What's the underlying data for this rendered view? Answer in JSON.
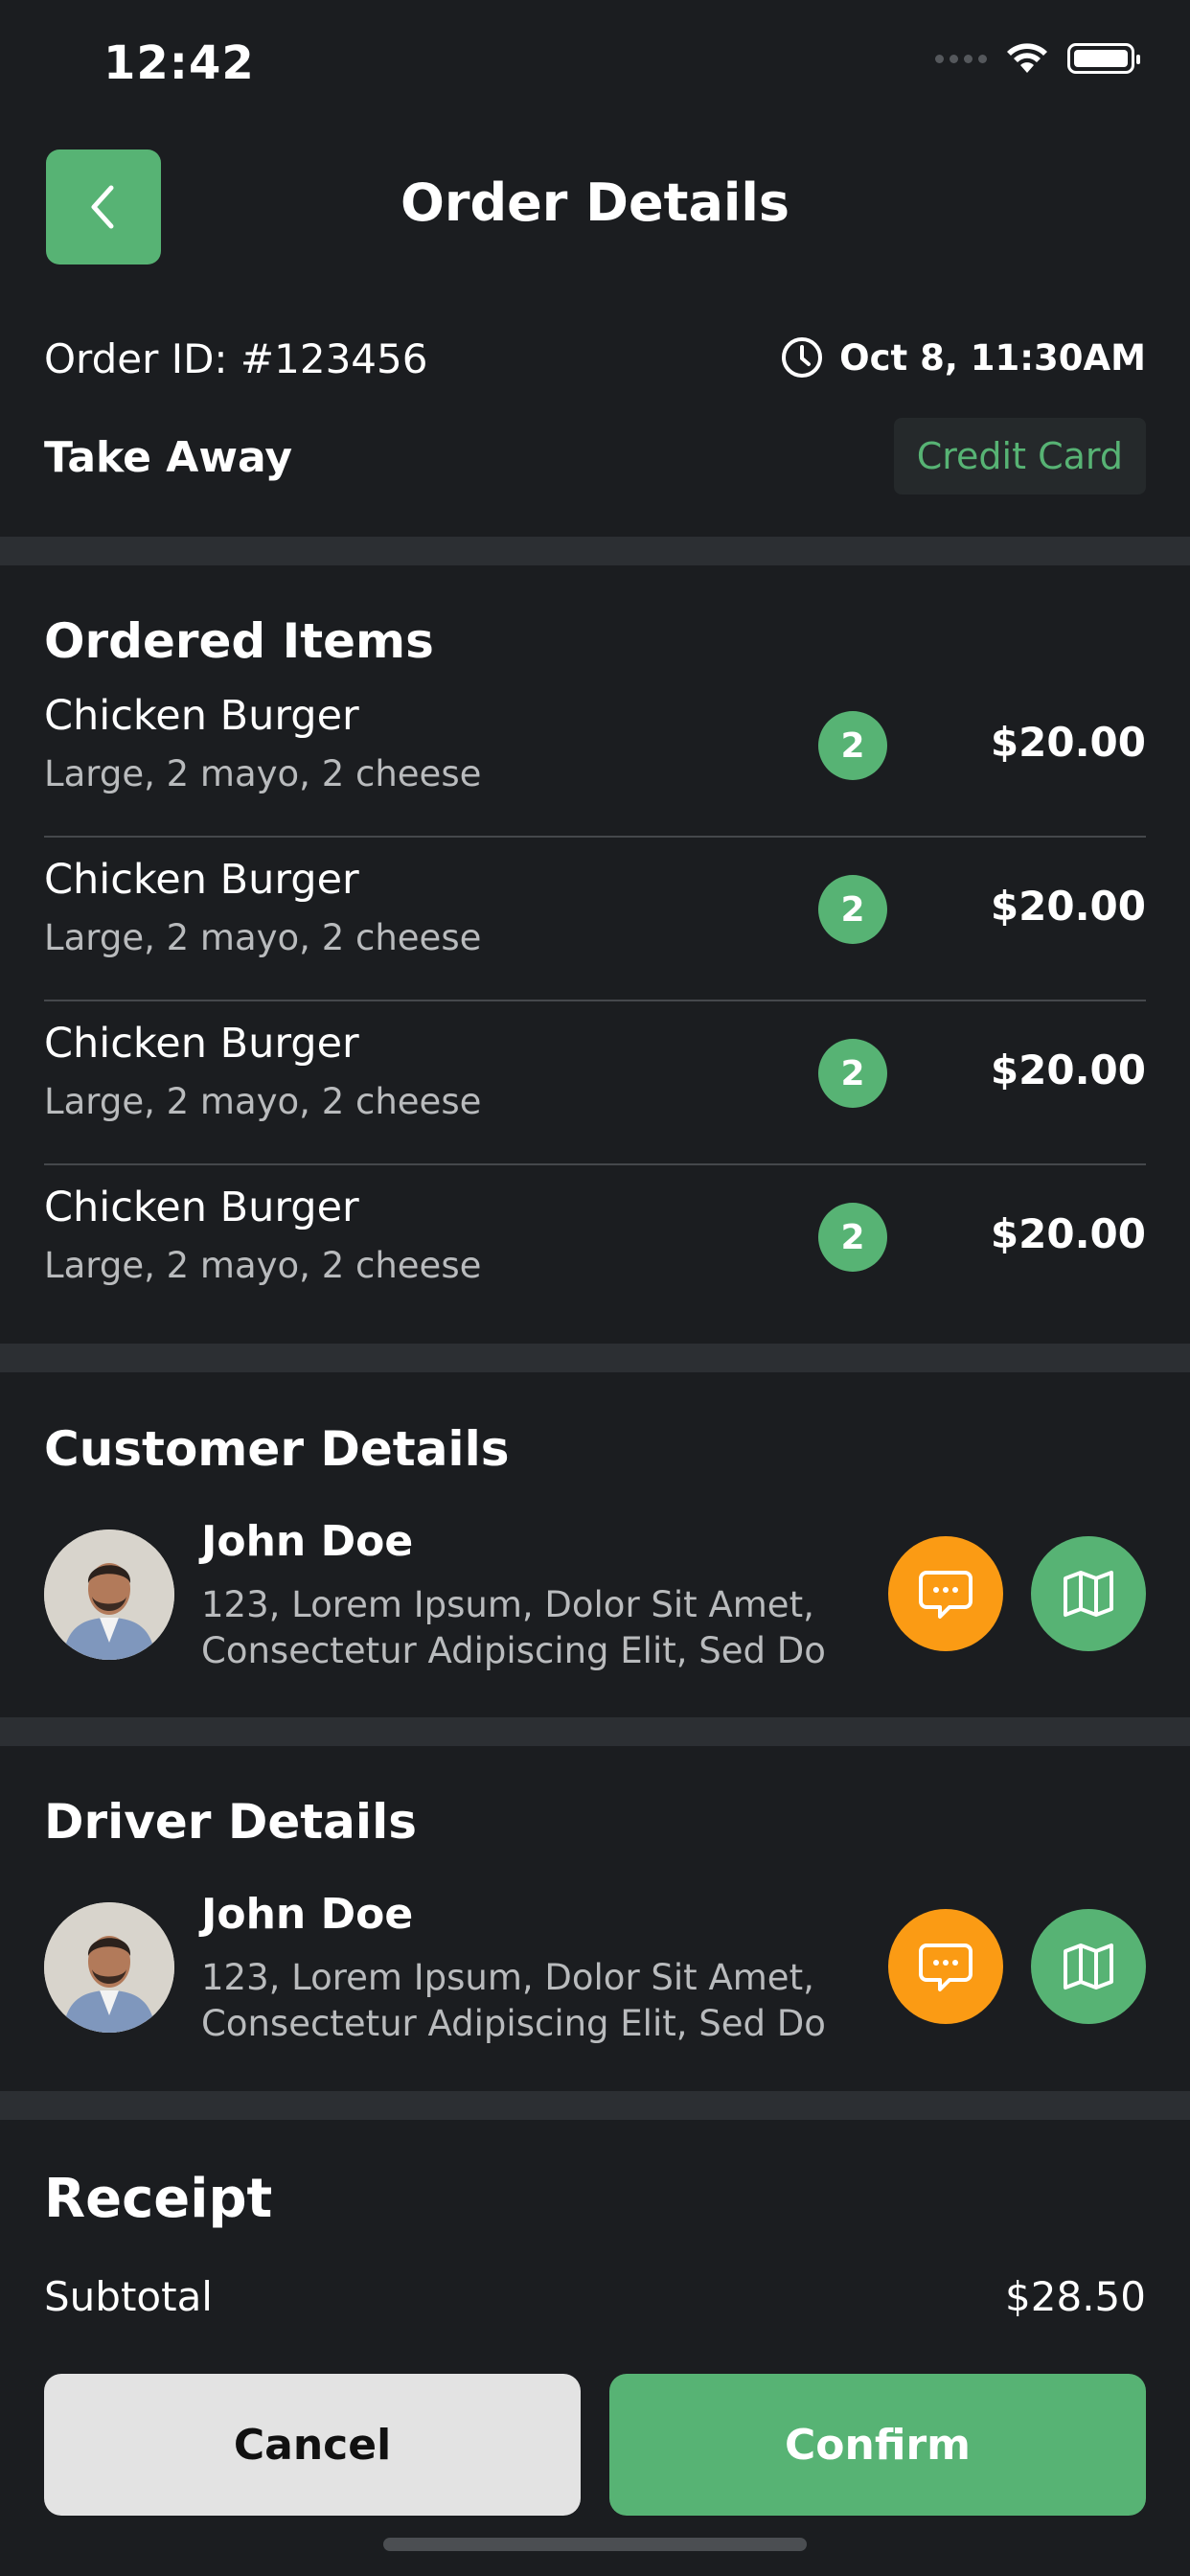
{
  "status_bar": {
    "time": "12:42"
  },
  "header": {
    "title": "Order Details"
  },
  "order": {
    "id_text": "Order ID: #123456",
    "time": "Oct 8, 11:30AM",
    "type": "Take Away",
    "payment": "Credit Card"
  },
  "ordered_items": {
    "title": "Ordered Items",
    "items": [
      {
        "name": "Chicken Burger",
        "options": "Large, 2 mayo, 2 cheese",
        "qty": "2",
        "price": "$20.00"
      },
      {
        "name": "Chicken Burger",
        "options": "Large, 2 mayo, 2 cheese",
        "qty": "2",
        "price": "$20.00"
      },
      {
        "name": "Chicken Burger",
        "options": "Large, 2 mayo, 2 cheese",
        "qty": "2",
        "price": "$20.00"
      },
      {
        "name": "Chicken Burger",
        "options": "Large, 2 mayo, 2 cheese",
        "qty": "2",
        "price": "$20.00"
      }
    ]
  },
  "customer": {
    "title": "Customer Details",
    "name": "John Doe",
    "address_line1": "123, Lorem Ipsum, Dolor Sit Amet,",
    "address_line2": "Consectetur Adipiscing Elit, Sed Do"
  },
  "driver": {
    "title": "Driver Details",
    "name": "John Doe",
    "address_line1": "123, Lorem Ipsum, Dolor Sit Amet,",
    "address_line2": "Consectetur Adipiscing Elit, Sed Do"
  },
  "receipt": {
    "title": "Receipt",
    "subtotal_label": "Subtotal",
    "subtotal_value": "$28.50"
  },
  "actions": {
    "cancel": "Cancel",
    "confirm": "Confirm"
  },
  "colors": {
    "background": "#1b1d20",
    "accent_green": "#57b374",
    "accent_orange": "#fb9b14",
    "separator": "#2c2f33"
  },
  "icons": {
    "back": "chevron-left-icon",
    "clock": "clock-icon",
    "chat": "chat-bubble-icon",
    "map": "map-icon"
  }
}
